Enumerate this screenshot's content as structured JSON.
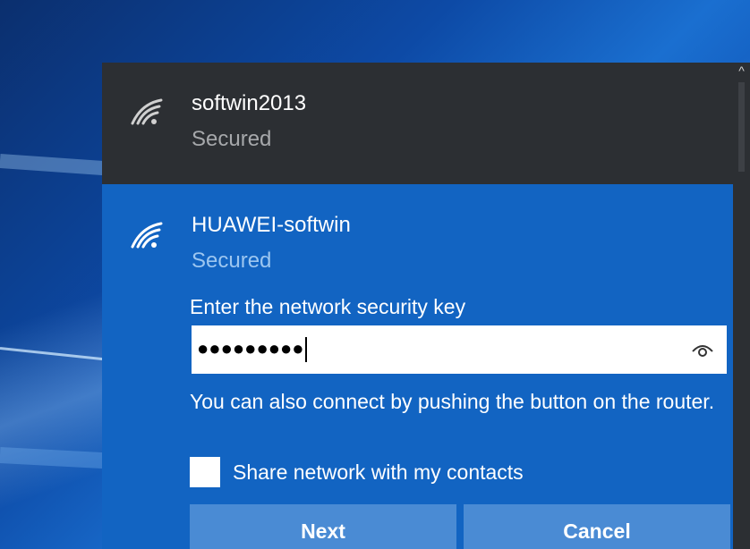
{
  "networks": [
    {
      "ssid": "softwin2013",
      "status": "Secured",
      "icon": "wifi-secured-icon"
    },
    {
      "ssid": "HUAWEI-softwin",
      "status": "Secured",
      "icon": "wifi-secured-icon"
    }
  ],
  "connect": {
    "key_label": "Enter the network security key",
    "key_value": "●●●●●●●●●",
    "reveal_icon": "eye-icon",
    "wps_text": "You can also connect by pushing the button on the router.",
    "share_label": "Share network with my contacts",
    "share_checked": false,
    "next_label": "Next",
    "cancel_label": "Cancel"
  },
  "scrollbar": {
    "up_glyph": "^"
  },
  "colors": {
    "active_panel": "#1264c2",
    "inactive_panel": "#2c2f33",
    "button": "#4a8bd4"
  }
}
